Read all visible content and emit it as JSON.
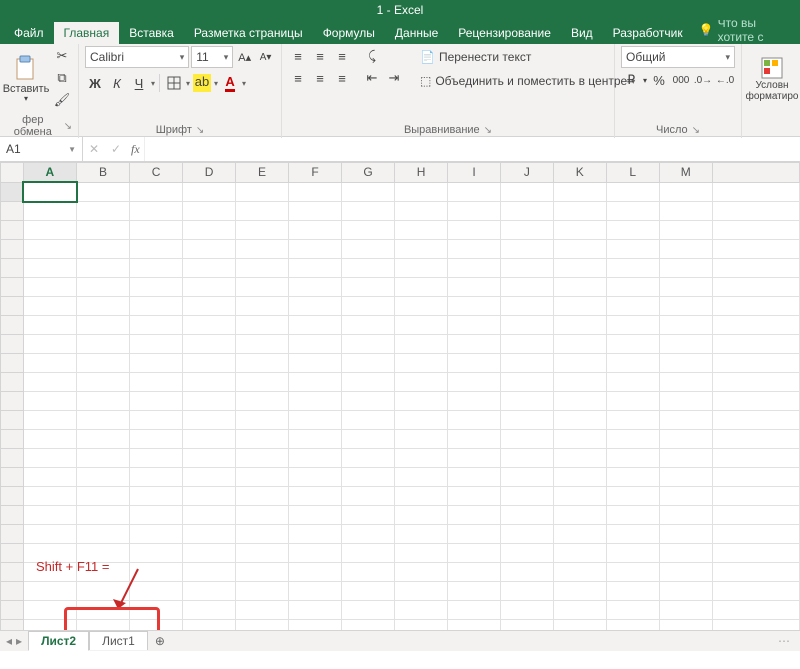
{
  "title": "1 - Excel",
  "tabs": {
    "file": "Файл",
    "home": "Главная",
    "insert": "Вставка",
    "layout": "Разметка страницы",
    "formulas": "Формулы",
    "data": "Данные",
    "review": "Рецензирование",
    "view": "Вид",
    "developer": "Разработчик"
  },
  "tellme": "Что вы хотите с",
  "clipboard": {
    "paste": "Вставить",
    "group": "фер обмена"
  },
  "font": {
    "name": "Calibri",
    "size": "11",
    "group": "Шрифт",
    "bold": "Ж",
    "italic": "К",
    "underline": "Ч"
  },
  "alignment": {
    "wrap": "Перенести текст",
    "merge": "Объединить и поместить в центре",
    "group": "Выравнивание"
  },
  "number": {
    "format": "Общий",
    "group": "Число"
  },
  "styles": {
    "condfmt": "Условн форматиро"
  },
  "namebox": "A1",
  "fx": "fx",
  "cols": [
    "A",
    "B",
    "C",
    "D",
    "E",
    "F",
    "G",
    "H",
    "I",
    "J",
    "K",
    "L",
    "M"
  ],
  "annotation": "Shift + F11 =",
  "sheet_tabs": {
    "active": "Лист2",
    "other": "Лист1",
    "add": "⊕"
  },
  "nav": {
    "first": "◂",
    "prev": "◂",
    "next": "▸",
    "last": "▸",
    "more": "⋯"
  }
}
